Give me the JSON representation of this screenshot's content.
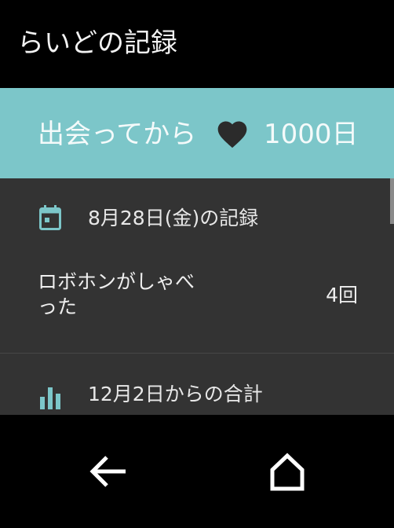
{
  "app_bar": {
    "title": "らいどの記録"
  },
  "banner": {
    "text": "出会ってから",
    "icon": "heart-icon",
    "count": "1000日"
  },
  "daily_section": {
    "icon": "calendar-icon",
    "label": "8月28日(金)の記録",
    "stats": [
      {
        "label": "ロボホンがしゃべった",
        "value": "4回"
      }
    ]
  },
  "total_section": {
    "icon": "bar-chart-icon",
    "label": "12月2日からの合計"
  },
  "nav_bar": {
    "back_icon": "back-arrow-icon",
    "home_icon": "home-icon"
  },
  "colors": {
    "accent": "#7cc6c9",
    "content_bg": "#333333",
    "bar_bg": "#000000"
  }
}
